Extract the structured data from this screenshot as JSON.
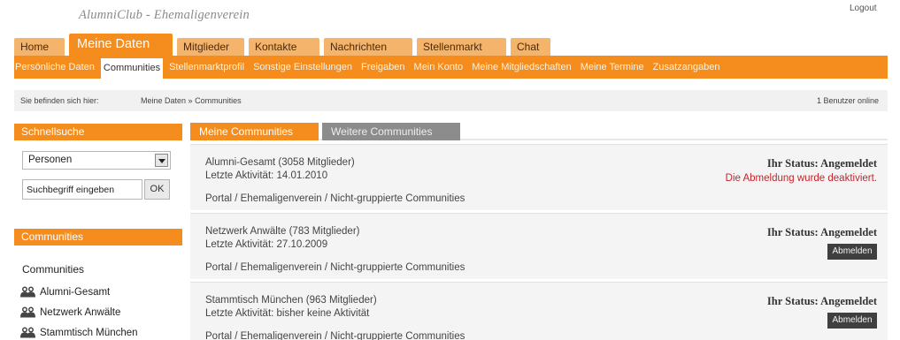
{
  "app": {
    "logo_text": "AlumniClub - Ehemaligenverein",
    "logout_label": "Logout"
  },
  "main_tabs": [
    {
      "label": "Home"
    },
    {
      "label": "Meine Daten"
    },
    {
      "label": "Mitglieder"
    },
    {
      "label": "Kontakte"
    },
    {
      "label": "Nachrichten"
    },
    {
      "label": "Stellenmarkt"
    },
    {
      "label": "Chat"
    }
  ],
  "sub_tabs": [
    {
      "label": "Persönliche Daten"
    },
    {
      "label": "Communities"
    },
    {
      "label": "Stellenmarktprofil"
    },
    {
      "label": "Sonstige Einstellungen"
    },
    {
      "label": "Freigaben"
    },
    {
      "label": "Mein Konto"
    },
    {
      "label": "Meine Mitgliedschaften"
    },
    {
      "label": "Meine Termine"
    },
    {
      "label": "Zusatzangaben"
    }
  ],
  "breadcrumb": {
    "prefix": "Sie befinden sich hier:",
    "items": [
      "Meine Daten",
      "Communities"
    ],
    "separator": "»",
    "online": "1 Benutzer online"
  },
  "sidebar": {
    "quicksearch_title": "Schnellsuche",
    "select_value": "Personen",
    "search_placeholder": "Suchbegriff eingeben",
    "ok_label": "OK",
    "communities_header": "Communities",
    "communities_title": "Communities",
    "items": [
      {
        "label": "Alumni-Gesamt"
      },
      {
        "label": "Netzwerk Anwälte"
      },
      {
        "label": "Stammtisch München"
      }
    ]
  },
  "content": {
    "tabs": [
      {
        "label": "Meine Communities"
      },
      {
        "label": "Weitere Communities"
      }
    ],
    "communities": [
      {
        "name": "Alumni-Gesamt (3058 Mitglieder)",
        "activity": "Letzte Aktivität: 14.01.2010",
        "path": "Portal / Ehemaligenverein / Nicht-gruppierte Communities",
        "status": "Ihr Status: Angemeldet",
        "note": "Die Abmeldung wurde deaktiviert."
      },
      {
        "name": "Netzwerk Anwälte (783 Mitglieder)",
        "activity": "Letzte Aktivität: 27.10.2009",
        "path": "Portal / Ehemaligenverein / Nicht-gruppierte Communities",
        "status": "Ihr Status: Angemeldet",
        "button": "Abmelden"
      },
      {
        "name": "Stammtisch München (963 Mitglieder)",
        "activity": "Letzte Aktivität: bisher keine Aktivität",
        "path": "Portal / Ehemaligenverein / Nicht-gruppierte Communities",
        "status": "Ihr Status: Angemeldet",
        "button": "Abmelden"
      }
    ]
  },
  "colors": {
    "accent": "#f58d1e",
    "inactive_tab": "#f4b46b",
    "error": "#c0262c",
    "button_dark": "#3f3f3f"
  },
  "icons": {
    "community_icon": "people-group-icon",
    "select_arrow": "chevron-down-icon"
  }
}
